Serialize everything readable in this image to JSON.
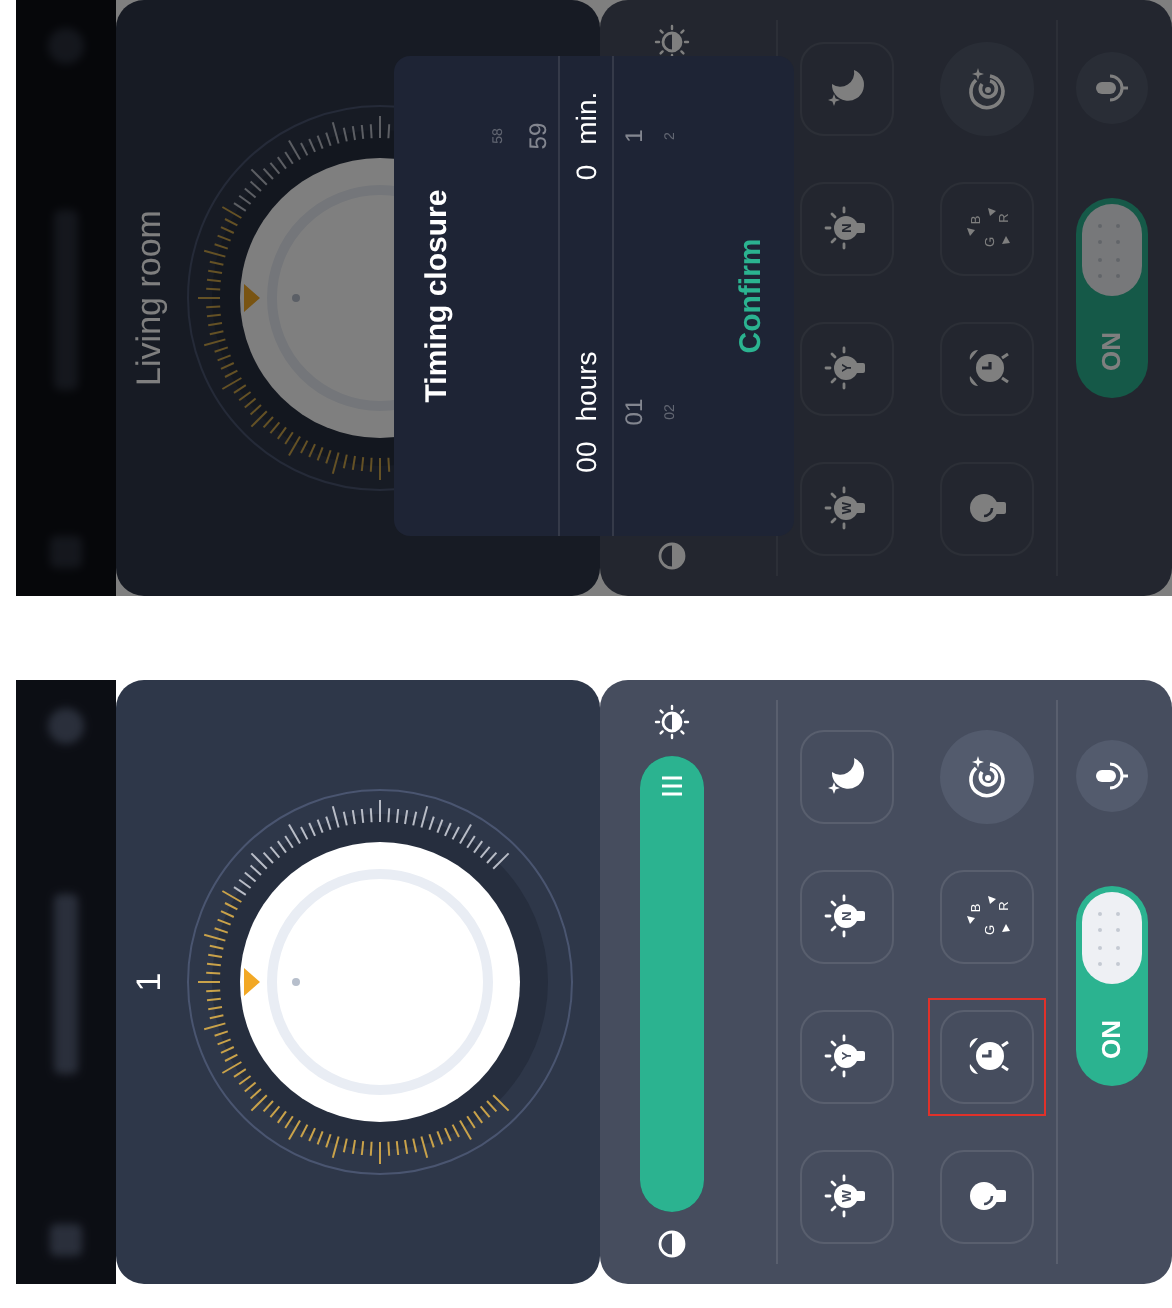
{
  "screens": [
    {
      "dimmed": true,
      "title": "Living room",
      "buttons": [
        {
          "kind": "bulb",
          "letter": "W",
          "highlighted": false
        },
        {
          "kind": "bulb",
          "letter": "Y",
          "highlighted": false
        },
        {
          "kind": "bulb",
          "letter": "N",
          "highlighted": false
        },
        {
          "kind": "moon",
          "highlighted": false
        },
        {
          "kind": "lamp",
          "highlighted": false
        },
        {
          "kind": "alarm",
          "highlighted": false
        },
        {
          "kind": "rgb",
          "letters": [
            "B",
            "R",
            "G"
          ],
          "highlighted": false
        },
        {
          "kind": "target",
          "highlighted": false
        }
      ],
      "power": {
        "label": "ON",
        "on": true
      },
      "dialog": {
        "title": "Timing closure",
        "columns": [
          {
            "unit": "hours",
            "items": [
              {
                "value": "00",
                "selected": true
              },
              {
                "value": "01",
                "selected": false
              },
              {
                "value": "02",
                "selected": false
              }
            ]
          },
          {
            "unit": "min.",
            "items": [
              {
                "value": "58",
                "selected": false
              },
              {
                "value": "59",
                "selected": false
              },
              {
                "value": "0",
                "selected": true
              },
              {
                "value": "1",
                "selected": false
              },
              {
                "value": "2",
                "selected": false
              }
            ]
          }
        ],
        "confirm": "Confirm"
      }
    },
    {
      "dimmed": false,
      "title": "1",
      "brightness": {
        "level": 1
      },
      "buttons": [
        {
          "kind": "bulb",
          "letter": "W",
          "highlighted": false
        },
        {
          "kind": "bulb",
          "letter": "Y",
          "highlighted": false
        },
        {
          "kind": "bulb",
          "letter": "N",
          "highlighted": false
        },
        {
          "kind": "moon",
          "highlighted": false
        },
        {
          "kind": "lamp",
          "highlighted": false
        },
        {
          "kind": "alarm",
          "highlighted": true
        },
        {
          "kind": "rgb",
          "letters": [
            "B",
            "R",
            "G"
          ],
          "highlighted": false
        },
        {
          "kind": "target",
          "highlighted": false
        }
      ],
      "power": {
        "label": "ON",
        "on": true
      }
    }
  ]
}
